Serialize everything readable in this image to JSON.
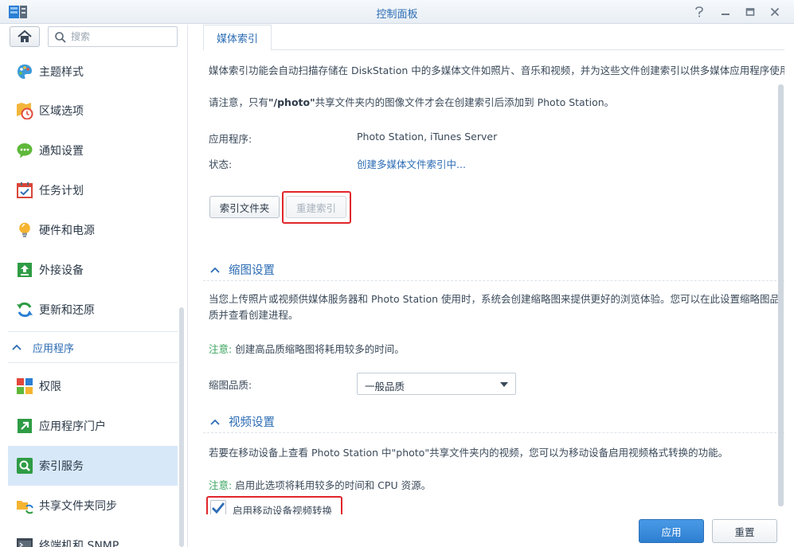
{
  "window": {
    "title": "控制面板",
    "controls": [
      "help-icon",
      "minimize-icon",
      "maximize-icon",
      "close-icon"
    ]
  },
  "sidebar": {
    "search_placeholder": "搜索",
    "items": [
      {
        "label": "主题样式",
        "icon": "palette-icon"
      },
      {
        "label": "区域选项",
        "icon": "clock-map-icon"
      },
      {
        "label": "通知设置",
        "icon": "chat-bubble-icon"
      },
      {
        "label": "任务计划",
        "icon": "calendar-check-icon"
      },
      {
        "label": "硬件和电源",
        "icon": "lightbulb-icon"
      },
      {
        "label": "外接设备",
        "icon": "upload-device-icon"
      },
      {
        "label": "更新和还原",
        "icon": "refresh-icon"
      }
    ],
    "section": {
      "label": "应用程序"
    },
    "app_items": [
      {
        "label": "权限",
        "icon": "squares-icon"
      },
      {
        "label": "应用程序门户",
        "icon": "portal-arrow-icon"
      },
      {
        "label": "索引服务",
        "icon": "search-index-icon",
        "active": true
      },
      {
        "label": "共享文件夹同步",
        "icon": "folder-sync-icon"
      },
      {
        "label": "终端机和 SNMP",
        "icon": "terminal-icon"
      }
    ]
  },
  "tabs": [
    {
      "label": "媒体索引",
      "active": true
    }
  ],
  "media_index": {
    "description": "媒体索引功能会自动扫描存储在 DiskStation 中的多媒体文件如照片、音乐和视频，并为这些文件创建索引以供多媒体应用程序使用。",
    "note_prefix": "请注意，只有",
    "note_folder": "\"/photo\"",
    "note_suffix": "共享文件夹内的图像文件才会在创建索引后添加到 Photo Station。",
    "app_label": "应用程序:",
    "app_value": "Photo Station, iTunes Server",
    "status_label": "状态:",
    "status_value": "创建多媒体文件索引中...",
    "btn_index_folder": "索引文件夹",
    "btn_rebuild": "重建索引"
  },
  "thumbnail": {
    "title": "缩图设置",
    "description": "当您上传照片或视频供媒体服务器和 Photo Station 使用时，系统会创建缩略图来提供更好的浏览体验。您可以在此设置缩略图品质并查看创建进程。",
    "note_label": "注意:",
    "note_text": "创建高品质缩略图将耗用较多的时间。",
    "quality_label": "缩图品质:",
    "quality_value": "一般品质"
  },
  "video": {
    "title": "视频设置",
    "description": "若要在移动设备上查看 Photo Station 中\"photo\"共享文件夹内的视频，您可以为移动设备启用视频格式转换的功能。",
    "note_label": "注意:",
    "note_text": "启用此选项将耗用较多的时间和 CPU 资源。",
    "checkbox_label": "启用移动设备视频转换",
    "checkbox_checked": true
  },
  "footer": {
    "apply": "应用",
    "reset": "重置"
  },
  "colors": {
    "accent": "#2b6cb5",
    "note_green": "#3aa35e",
    "highlight_red": "#e0262b",
    "active_bg": "#d7e8f8"
  }
}
